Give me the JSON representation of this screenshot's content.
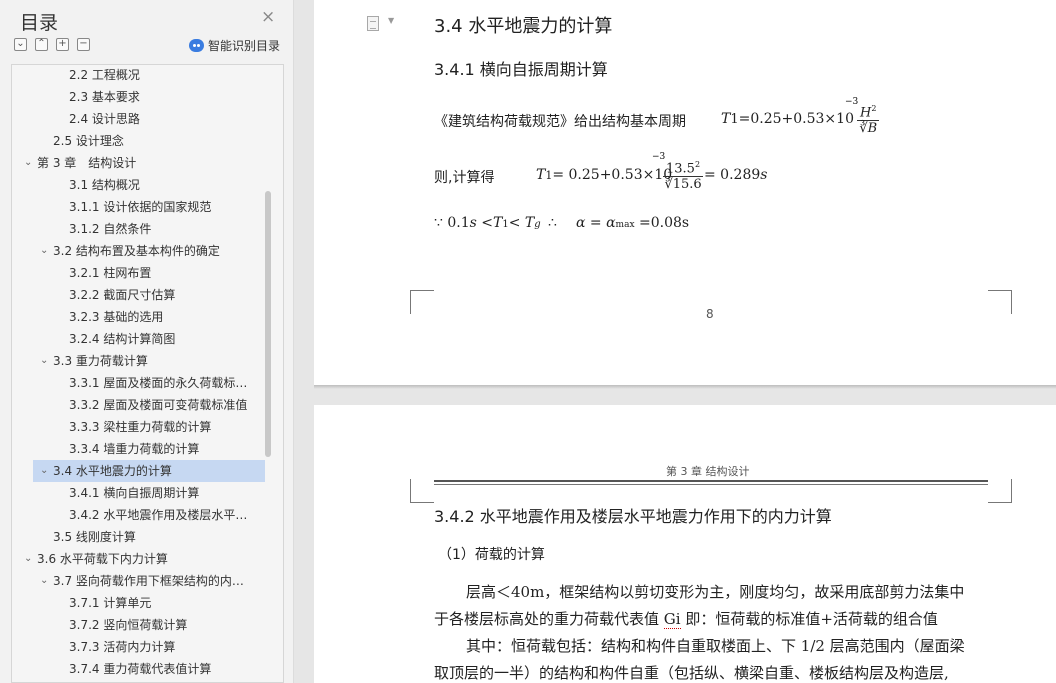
{
  "sidebar": {
    "title": "目录",
    "close_icon": "×",
    "tools": [
      "⌄",
      "⌃",
      "+",
      "−"
    ],
    "smart_label": "智能识别目录",
    "toc": [
      {
        "level": 3,
        "label": "2.2 工程概况"
      },
      {
        "level": 3,
        "label": "2.3 基本要求"
      },
      {
        "level": 3,
        "label": "2.4 设计思路"
      },
      {
        "level": 2,
        "label": "2.5 设计理念"
      },
      {
        "level": 1,
        "label": "第 3 章　结构设计",
        "chevron": "⌄"
      },
      {
        "level": 3,
        "label": "3.1 结构概况"
      },
      {
        "level": 3,
        "label": "3.1.1 设计依据的国家规范"
      },
      {
        "level": 3,
        "label": "3.1.2 自然条件"
      },
      {
        "level": 2,
        "label": "3.2 结构布置及基本构件的确定",
        "chevron": "⌄"
      },
      {
        "level": 3,
        "label": "3.2.1 柱网布置"
      },
      {
        "level": 3,
        "label": "3.2.2 截面尺寸估算"
      },
      {
        "level": 3,
        "label": "3.2.3 基础的选用"
      },
      {
        "level": 3,
        "label": "3.2.4 结构计算简图"
      },
      {
        "level": 2,
        "label": "3.3 重力荷载计算",
        "chevron": "⌄"
      },
      {
        "level": 3,
        "label": "3.3.1 屋面及楼面的永久荷载标准值"
      },
      {
        "level": 3,
        "label": "3.3.2 屋面及楼面可变荷载标准值"
      },
      {
        "level": 3,
        "label": "3.3.3 梁柱重力荷载的计算"
      },
      {
        "level": 3,
        "label": "3.3.4 墙重力荷载的计算"
      },
      {
        "level": 2,
        "label": "3.4 水平地震力的计算",
        "chevron": "⌄",
        "selected": true
      },
      {
        "level": 3,
        "label": "3.4.1 横向自振周期计算"
      },
      {
        "level": 3,
        "label": "3.4.2 水平地震作用及楼层水平地震力作用下的内力计算"
      },
      {
        "level": 2,
        "label": "3.5 线刚度计算"
      },
      {
        "level": 1,
        "label": "3.6 水平荷载下内力计算",
        "chevron": "⌄"
      },
      {
        "level": 2,
        "label": "3.7 竖向荷载作用下框架结构的内力计算",
        "chevron": "⌄"
      },
      {
        "level": 3,
        "label": "3.7.1 计算单元"
      },
      {
        "level": 3,
        "label": "3.7.2 竖向恒荷载计算"
      },
      {
        "level": 3,
        "label": "3.7.3 活荷内力计算"
      },
      {
        "level": 3,
        "label": "3.7.4 重力荷载代表值计算"
      }
    ]
  },
  "page1": {
    "heading": "3.4  水平地震力的计算",
    "subheading": "3.4.1 横向自振周期计算",
    "para1_text": "《建筑结构荷载规范》给出结构基本周期",
    "para1_T": "T",
    "para1_T_sub": "1",
    "para1_expr": "=0.25+0.53×10",
    "para1_exp": "−3",
    "para1_num": "H",
    "para1_num_sup": "2",
    "para1_den": "∛B",
    "para2_text": "则,计算得",
    "para2_T": "T",
    "para2_T_sub": "1",
    "para2_expr": "= 0.25+0.53×10",
    "para2_exp": "−3",
    "para2_num": "13.5",
    "para2_num_sup": "2",
    "para2_den": "∛15.6",
    "para2_result": "= 0.289",
    "para2_unit": "s",
    "para3_because": "∵",
    "para3_cond": "0.1",
    "para3_s": "s",
    "para3_lt1": " <",
    "para3_T1": "T",
    "para3_T1_sub": "1",
    "para3_lt2": "< ",
    "para3_Tg": "T",
    "para3_Tg_sub": "g",
    "para3_therefore": "∴",
    "para3_alpha": "α = α",
    "para3_alpha_sub": "max",
    "para3_alpha_val": " =0.08s",
    "page_number": "8"
  },
  "page2": {
    "running_head": "第 3 章  结构设计",
    "heading": "3.4.2 水平地震作用及楼层水平地震力作用下的内力计算",
    "sub": "（1）荷载的计算",
    "p1a": "层高＜40m，框架结构以剪切变形为主，刚度均匀，故采用底部剪力法集中",
    "p1b_pre": "于各楼层标高处的重力荷载代表值 ",
    "p1b_gi": "Gi",
    "p1b_post": "   即：恒荷载的标准值+活荷载的组合值",
    "p2a": "其中：恒荷载包括：结构和构件自重取楼面上、下 1/2 层高范围内（屋面梁",
    "p2b": "取顶层的一半）的结构和构件自重（包括纵、横梁自重、楼板结构层及构造层,"
  }
}
